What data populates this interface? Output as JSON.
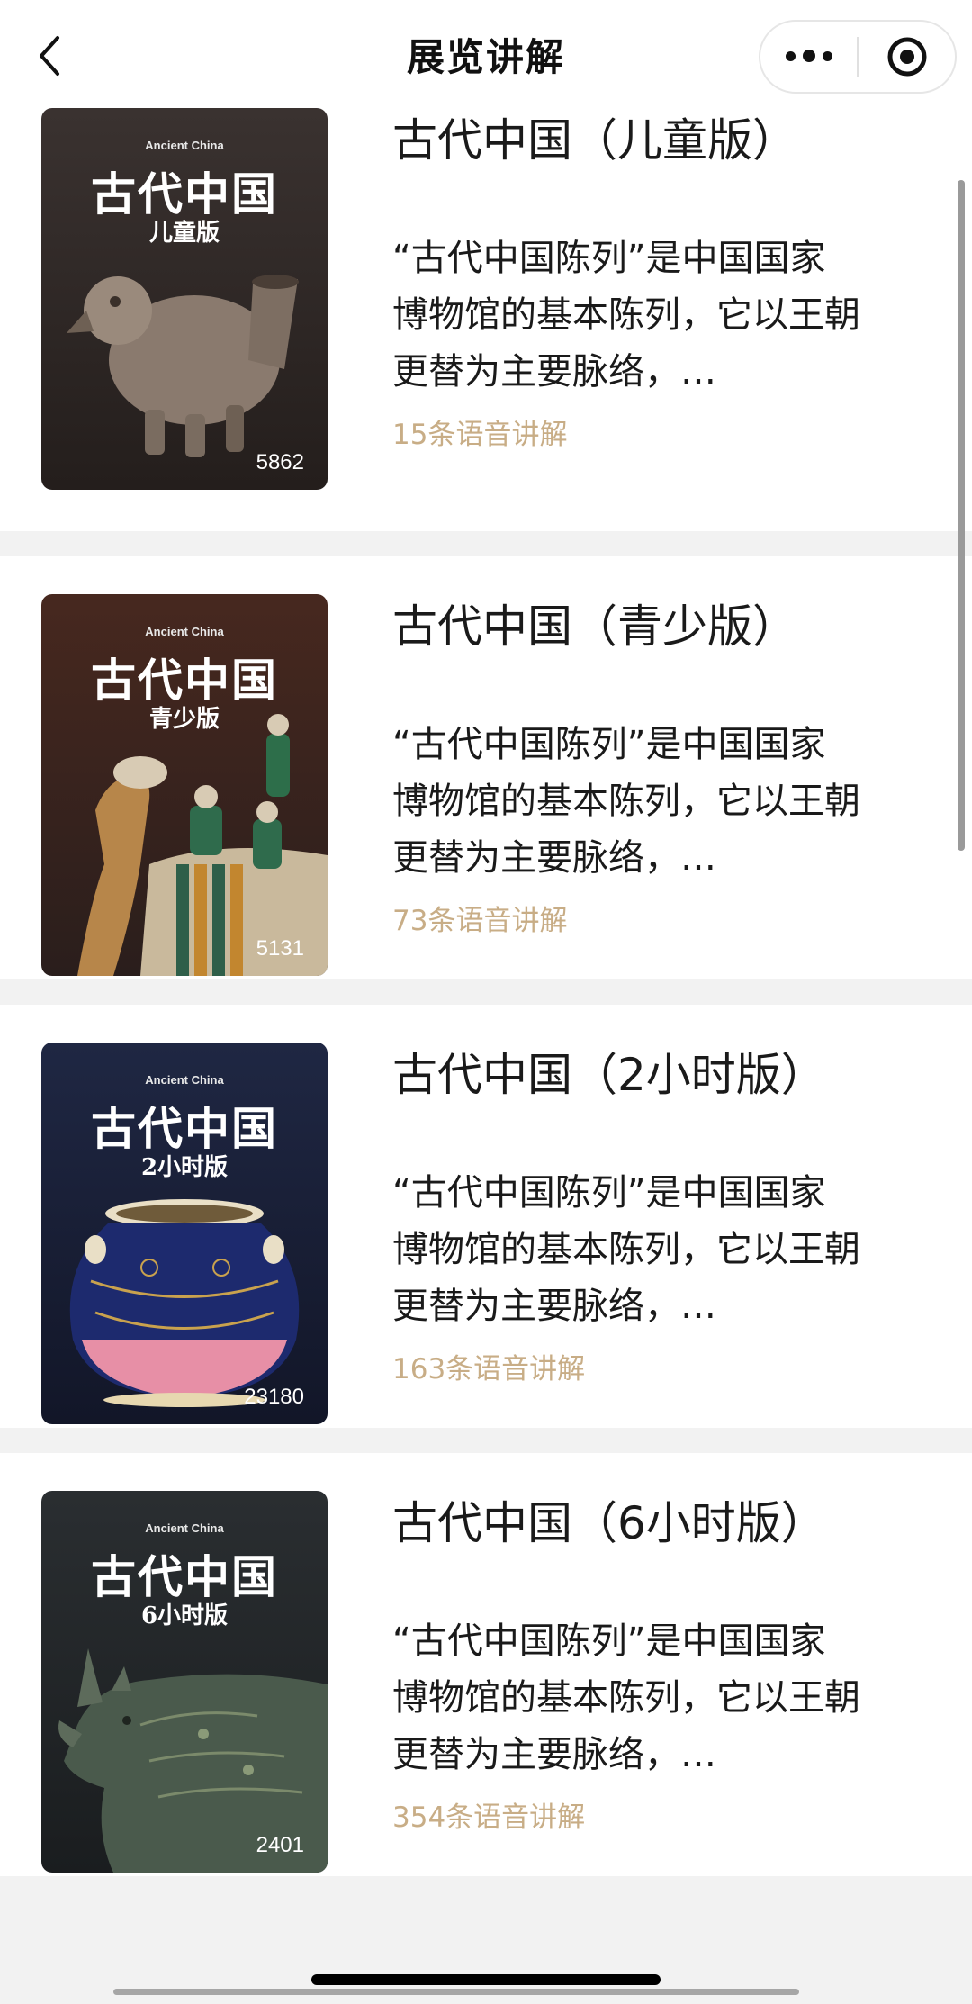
{
  "navbar": {
    "title": "展览讲解"
  },
  "items": [
    {
      "cover_en": "Ancient China",
      "cover_title": "古代中国",
      "cover_sub": "儿童版",
      "views": "5862",
      "title": "古代中国（儿童版）",
      "desc": "“古代中国陈列”是中国国家博物馆的基本陈列，它以王朝更替为主要脉络，…",
      "count": "15条语音讲解"
    },
    {
      "cover_en": "Ancient China",
      "cover_title": "古代中国",
      "cover_sub": "青少版",
      "views": "5131",
      "title": "古代中国（青少版）",
      "desc": "“古代中国陈列”是中国国家博物馆的基本陈列，它以王朝更替为主要脉络，…",
      "count": "73条语音讲解"
    },
    {
      "cover_en": "Ancient China",
      "cover_title": "古代中国",
      "cover_sub": "2小时版",
      "views": "23180",
      "title": "古代中国（2小时版）",
      "desc": "“古代中国陈列”是中国国家博物馆的基本陈列，它以王朝更替为主要脉络，…",
      "count": "163条语音讲解"
    },
    {
      "cover_en": "Ancient China",
      "cover_title": "古代中国",
      "cover_sub": "6小时版",
      "views": "2401",
      "title": "古代中国（6小时版）",
      "desc": "“古代中国陈列”是中国国家博物馆的基本陈列，它以王朝更替为主要脉络，…",
      "count": "354条语音讲解"
    }
  ],
  "colors": {
    "accent": "#c8ad86",
    "cover1": "#2b2523",
    "cover2": "#3a2421",
    "cover3": "#171d33",
    "cover4": "#1f2326"
  }
}
